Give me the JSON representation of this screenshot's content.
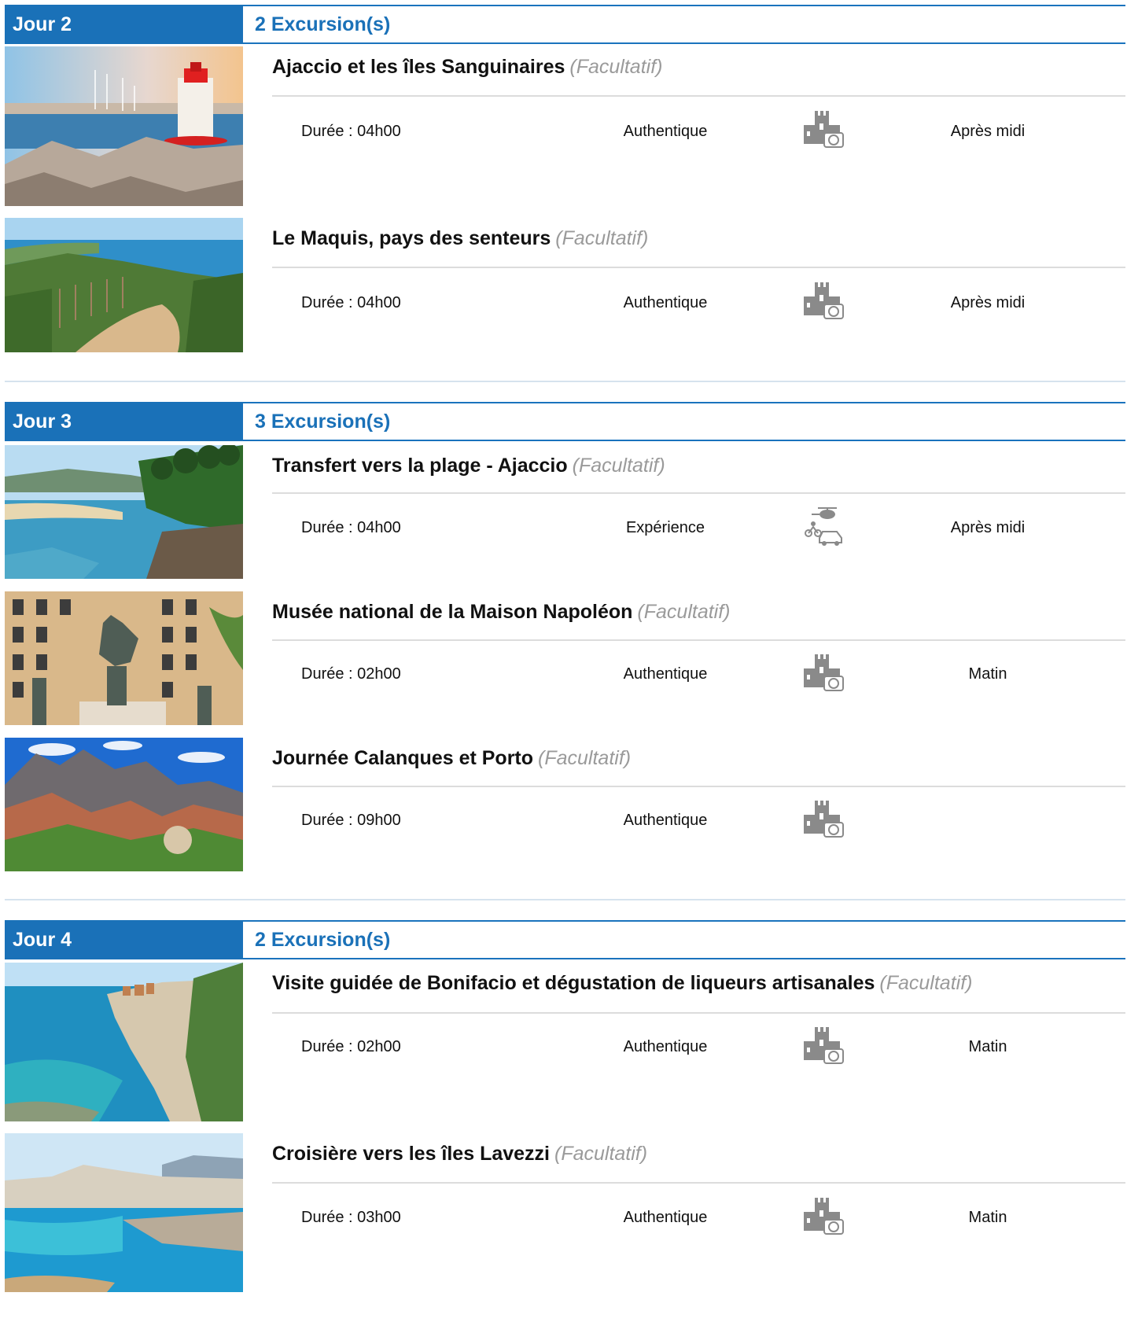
{
  "days": [
    {
      "label": "Jour 2",
      "count": "2 Excursion(s)",
      "excursions": [
        {
          "title": "Ajaccio et les îles Sanguinaires",
          "optional": "(Facultatif)",
          "duration": "Durée : 04h00",
          "style": "Authentique",
          "icon": "castle-camera-icon",
          "time": "Après midi",
          "image": "lighthouse-harbor-photo"
        },
        {
          "title": "Le Maquis, pays des senteurs",
          "optional": "(Facultatif)",
          "duration": "Durée : 04h00",
          "style": "Authentique",
          "icon": "castle-camera-icon",
          "time": "Après midi",
          "image": "maquis-coast-photo"
        }
      ]
    },
    {
      "label": "Jour 3",
      "count": "3 Excursion(s)",
      "excursions": [
        {
          "title": "Transfert vers la plage - Ajaccio",
          "optional": "(Facultatif)",
          "duration": "Durée : 04h00",
          "style": "Expérience",
          "icon": "transport-vehicles-icon",
          "time": "Après midi",
          "image": "beach-cove-photo"
        },
        {
          "title": "Musée national de la Maison Napoléon",
          "optional": "(Facultatif)",
          "duration": "Durée : 02h00",
          "style": "Authentique",
          "icon": "castle-camera-icon",
          "time": "Matin",
          "image": "napoleon-statue-photo"
        },
        {
          "title": "Journée Calanques et Porto",
          "optional": "(Facultatif)",
          "duration": "Durée : 09h00",
          "style": "Authentique",
          "icon": "castle-camera-icon",
          "time": "",
          "image": "calanques-mountains-photo"
        }
      ]
    },
    {
      "label": "Jour 4",
      "count": "2 Excursion(s)",
      "excursions": [
        {
          "title": "Visite guidée de Bonifacio et dégustation de liqueurs artisanales",
          "optional": "(Facultatif)",
          "duration": "Durée : 02h00",
          "style": "Authentique",
          "icon": "castle-camera-icon",
          "time": "Matin",
          "image": "bonifacio-cliffs-photo"
        },
        {
          "title": "Croisière vers les îles Lavezzi",
          "optional": "(Facultatif)",
          "duration": "Durée : 03h00",
          "style": "Authentique",
          "icon": "castle-camera-icon",
          "time": "Matin",
          "image": "lavezzi-islands-photo"
        }
      ]
    }
  ]
}
